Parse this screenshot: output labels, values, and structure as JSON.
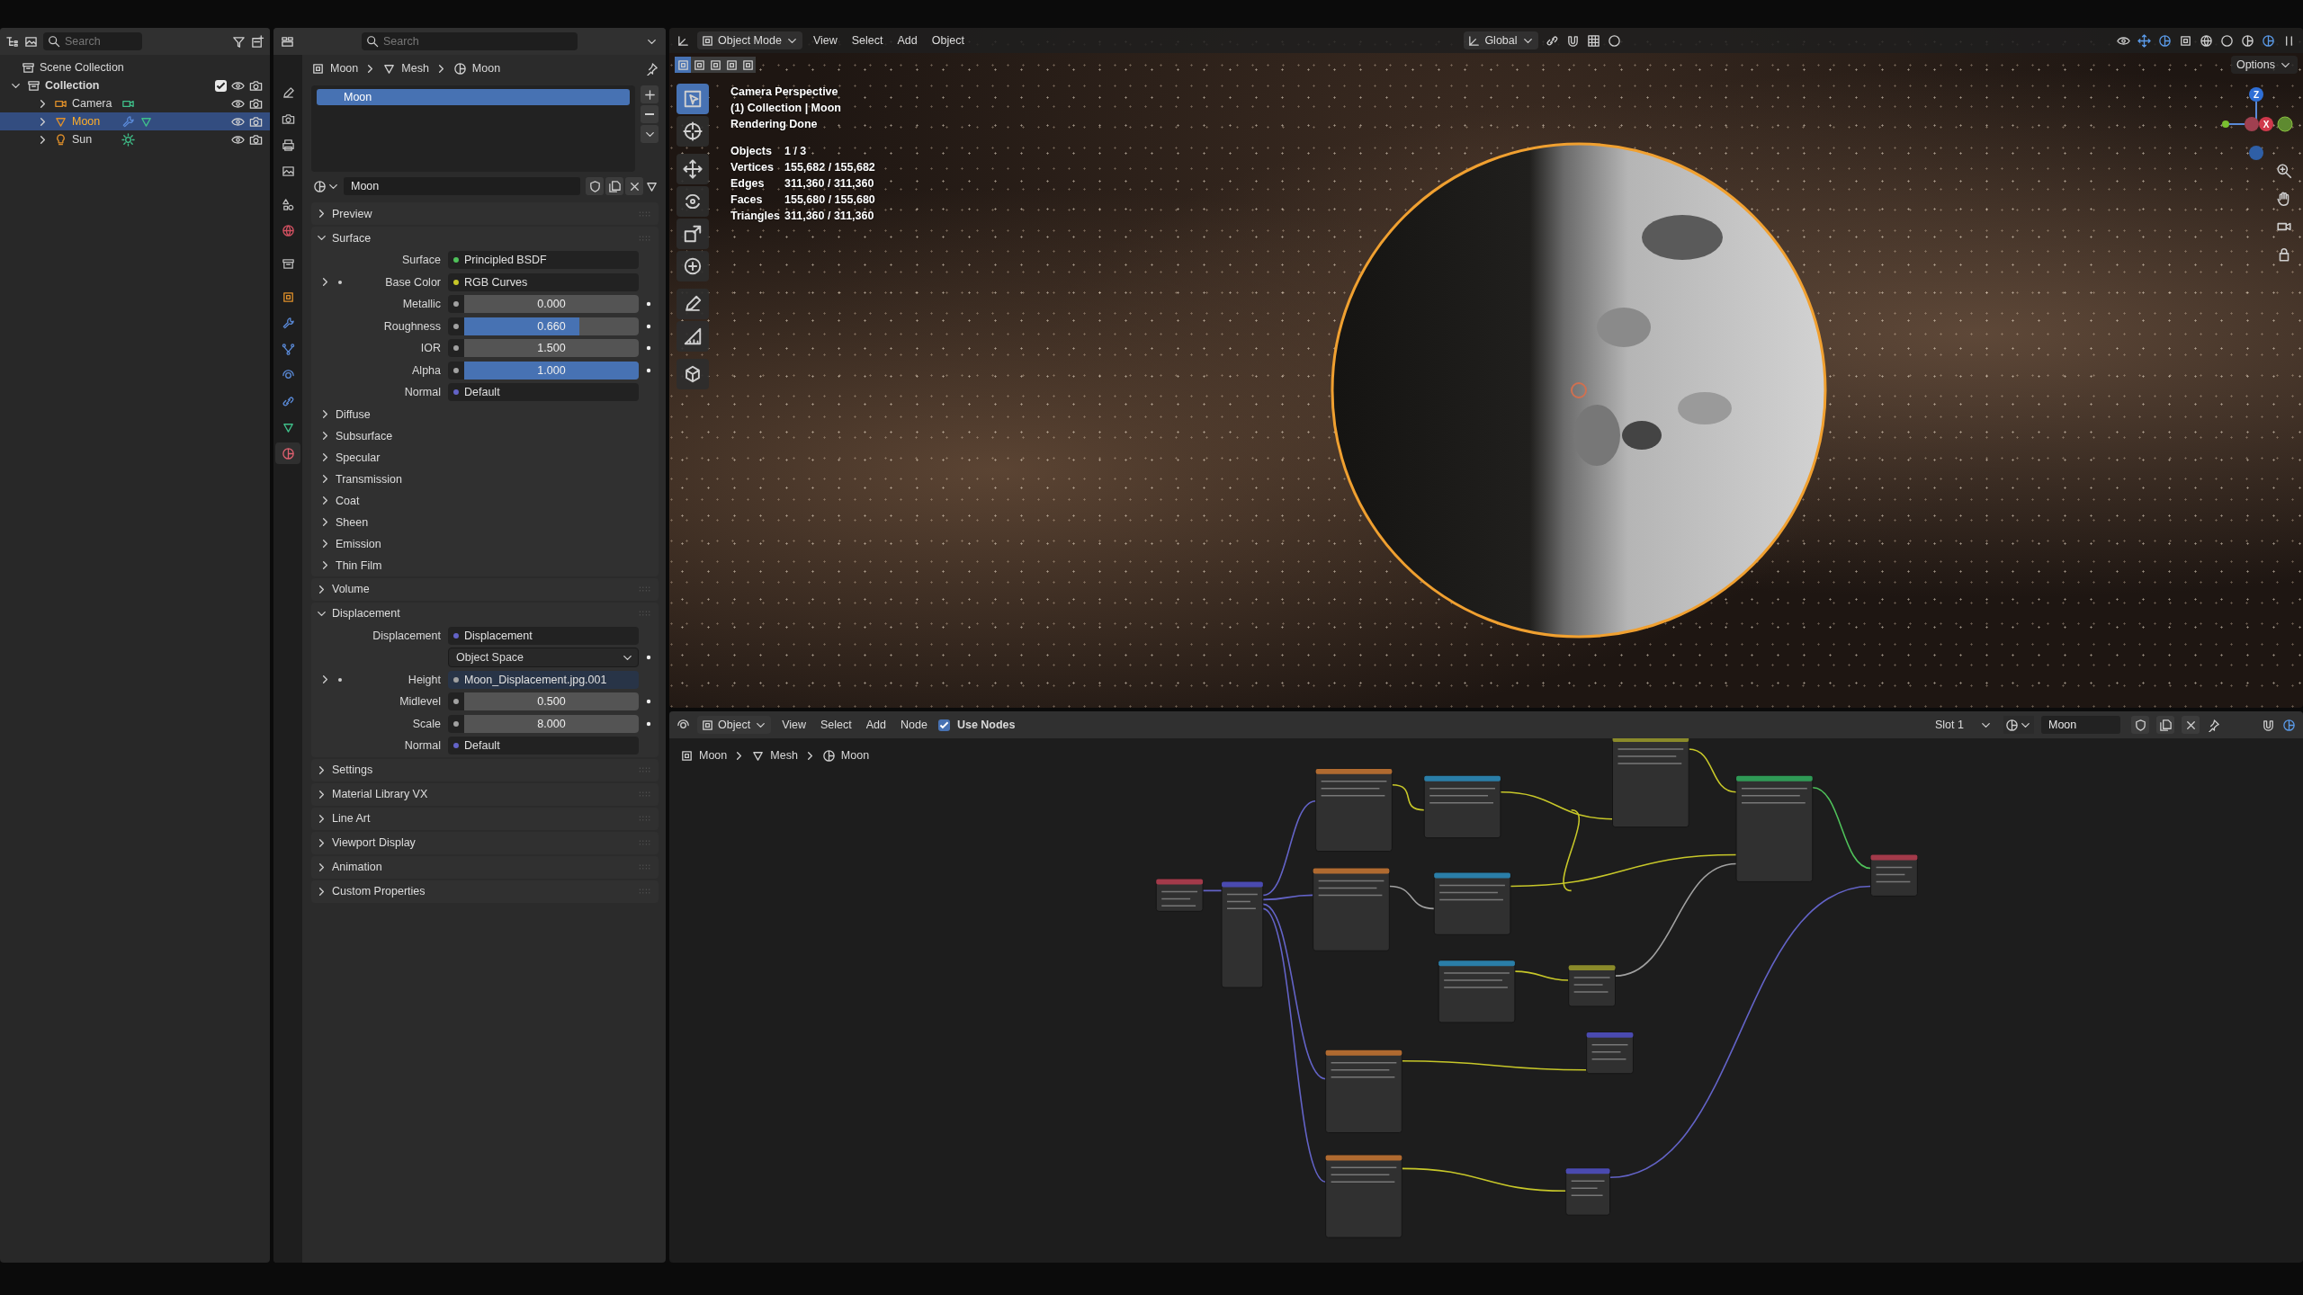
{
  "outliner": {
    "search": {
      "placeholder": "Search"
    },
    "scene_collection": "Scene Collection",
    "collection": {
      "label": "Collection",
      "expanded": true,
      "checked": true
    },
    "objects": [
      {
        "label": "Camera",
        "kind": "camera",
        "selected": false,
        "expanded": false
      },
      {
        "label": "Moon",
        "kind": "mesh",
        "selected": true,
        "expanded": false
      },
      {
        "label": "Sun",
        "kind": "light",
        "selected": false,
        "expanded": false
      }
    ]
  },
  "properties": {
    "search": {
      "placeholder": "Search"
    },
    "tabs": [
      {
        "kind": "tool",
        "selected": false
      },
      {
        "kind": "render",
        "selected": false
      },
      {
        "kind": "output",
        "selected": false
      },
      {
        "kind": "view_layer",
        "selected": false
      },
      {
        "kind": "scene",
        "selected": false
      },
      {
        "kind": "world",
        "selected": false
      },
      {
        "kind": "collection",
        "selected": false
      },
      {
        "kind": "object",
        "selected": false
      },
      {
        "kind": "modifier",
        "selected": false
      },
      {
        "kind": "particles",
        "selected": false
      },
      {
        "kind": "physics",
        "selected": false
      },
      {
        "kind": "constraints",
        "selected": false
      },
      {
        "kind": "data",
        "selected": false
      },
      {
        "kind": "material",
        "selected": true
      }
    ],
    "breadcrumb": [
      "Moon",
      "Mesh",
      "Moon"
    ],
    "material_slots": [
      {
        "label": "Moon",
        "selected": true
      }
    ],
    "material_name": "Moon",
    "sections": [
      {
        "title": "Preview",
        "expanded": false
      },
      {
        "title": "Surface",
        "expanded": true,
        "rows": [
          {
            "kind": "link",
            "label": "Surface",
            "value": "Principled BSDF",
            "color": "#4fc15a"
          },
          {
            "kind": "link",
            "label": "Base Color",
            "value": "RGB Curves",
            "color": "#c7c729",
            "expanded": false
          },
          {
            "kind": "slider",
            "label": "Metallic",
            "value": "0.000",
            "level": 0,
            "color": "#a1a1a1"
          },
          {
            "kind": "slider",
            "label": "Roughness",
            "value": "0.660",
            "level": 0.66,
            "color": "#a1a1a1"
          },
          {
            "kind": "number",
            "label": "IOR",
            "value": "1.500",
            "color": "#a1a1a1"
          },
          {
            "kind": "slider",
            "label": "Alpha",
            "value": "1.000",
            "level": 1,
            "color": "#a1a1a1"
          },
          {
            "kind": "link",
            "label": "Normal",
            "value": "Default",
            "color": "#6363c7"
          }
        ],
        "subpanels": [
          {
            "title": "Diffuse",
            "expanded": false
          },
          {
            "title": "Subsurface",
            "expanded": false
          },
          {
            "title": "Specular",
            "expanded": false
          },
          {
            "title": "Transmission",
            "expanded": false
          },
          {
            "title": "Coat",
            "expanded": false
          },
          {
            "title": "Sheen",
            "expanded": false
          },
          {
            "title": "Emission",
            "expanded": false
          },
          {
            "title": "Thin Film",
            "expanded": false
          }
        ]
      },
      {
        "title": "Volume",
        "expanded": false
      },
      {
        "title": "Displacement",
        "expanded": true,
        "rows": [
          {
            "kind": "link",
            "label": "Displacement",
            "value": "Displacement",
            "color": "#6363c7"
          },
          {
            "kind": "dropdown",
            "value": "Object Space"
          },
          {
            "kind": "link",
            "label": "Height",
            "value": "Moon_Displacement.jpg.001",
            "color": "#a1a1a1",
            "expanded": false
          },
          {
            "kind": "number",
            "label": "Midlevel",
            "value": "0.500",
            "color": "#a1a1a1"
          },
          {
            "kind": "number",
            "label": "Scale",
            "value": "8.000",
            "color": "#a1a1a1"
          },
          {
            "kind": "link",
            "label": "Normal",
            "value": "Default",
            "color": "#6363c7"
          }
        ]
      },
      {
        "title": "Settings",
        "expanded": false
      },
      {
        "title": "Material Library VX",
        "expanded": false
      },
      {
        "title": "Line Art",
        "expanded": false
      },
      {
        "title": "Viewport Display",
        "expanded": false
      },
      {
        "title": "Animation",
        "expanded": false
      },
      {
        "title": "Custom Properties",
        "expanded": false
      }
    ]
  },
  "viewport": {
    "header": {
      "mode": "Object Mode",
      "menus": [
        "View",
        "Select",
        "Add",
        "Object"
      ],
      "orientation": "Global",
      "options": "Options"
    },
    "select_modes": [
      {
        "selected": true
      },
      {
        "selected": false
      },
      {
        "selected": false
      },
      {
        "selected": false
      },
      {
        "selected": false
      }
    ],
    "tools": [
      {
        "kind": "select",
        "selected": true
      },
      {
        "kind": "cursor",
        "selected": false
      },
      {
        "kind": "move",
        "selected": false
      },
      {
        "kind": "rotate",
        "selected": false
      },
      {
        "kind": "scale",
        "selected": false
      },
      {
        "kind": "transform",
        "selected": false
      },
      {
        "kind": "annotate",
        "selected": false
      },
      {
        "kind": "measure",
        "selected": false
      },
      {
        "kind": "add_cube",
        "selected": false
      }
    ],
    "overlay": {
      "lines": [
        "Camera Perspective",
        "(1) Collection | Moon",
        "Rendering Done"
      ],
      "stats": [
        {
          "label": "Objects",
          "value": "1 / 3"
        },
        {
          "label": "Vertices",
          "value": "155,682 / 155,682"
        },
        {
          "label": "Edges",
          "value": "311,360 / 311,360"
        },
        {
          "label": "Faces",
          "value": "155,680 / 155,680"
        },
        {
          "label": "Triangles",
          "value": "311,360 / 311,360"
        }
      ]
    },
    "gizmo_axes": [
      {
        "label": "Z",
        "color": "#2f6fd6"
      },
      {
        "label": "X",
        "color": "#d0394c"
      }
    ]
  },
  "node_editor": {
    "header": {
      "editor": "Object",
      "menus": [
        "View",
        "Select",
        "Add",
        "Node"
      ],
      "use_nodes": {
        "label": "Use Nodes",
        "checked": true
      },
      "slot": "Slot 1",
      "material": "Moon"
    },
    "breadcrumb": [
      "Moon",
      "Mesh",
      "Moon"
    ]
  }
}
